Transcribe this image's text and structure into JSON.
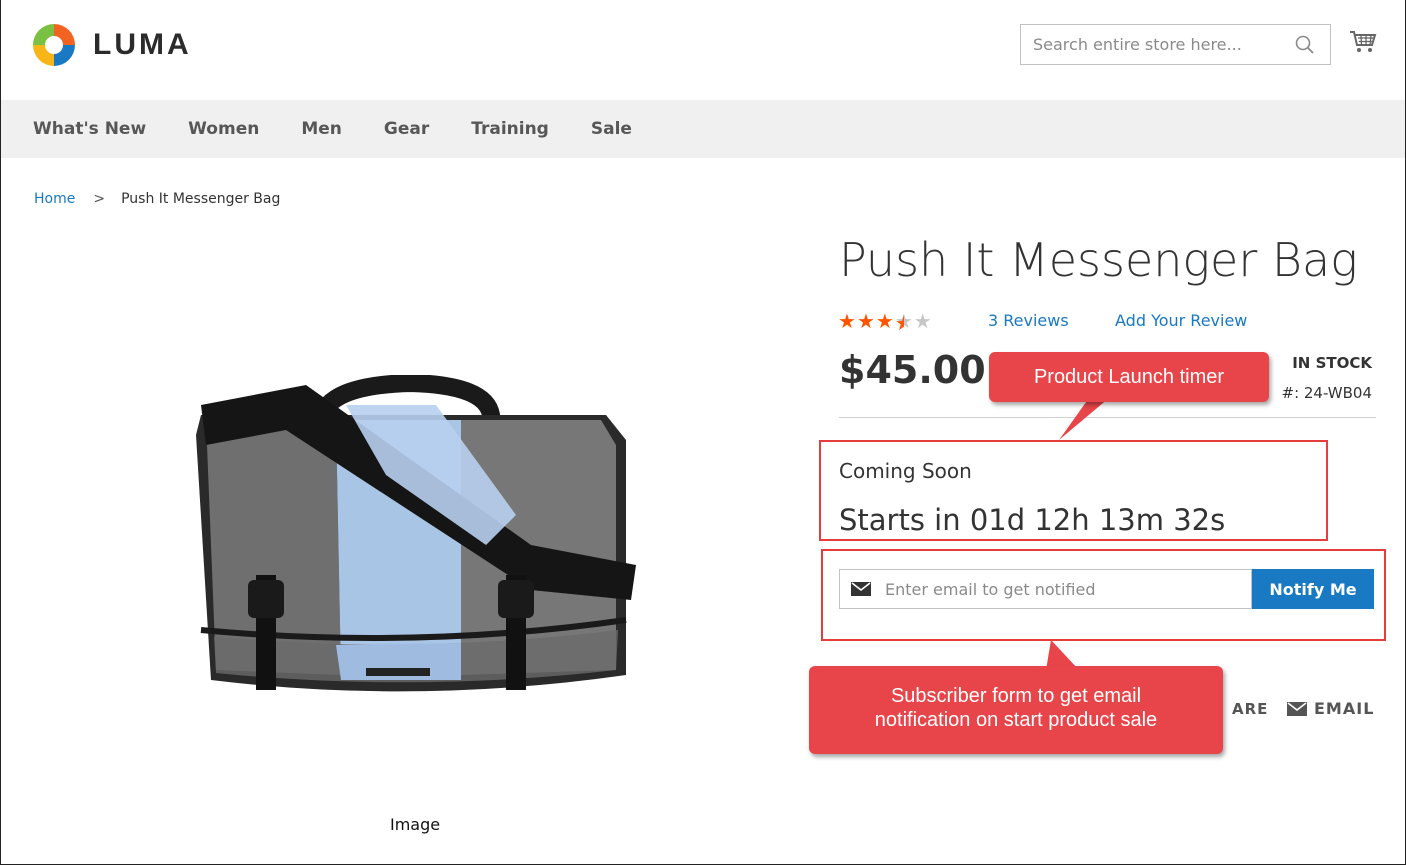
{
  "header": {
    "logo_text": "LUMA",
    "search_placeholder": "Search entire store here..."
  },
  "nav": {
    "items": [
      "What's New",
      "Women",
      "Men",
      "Gear",
      "Training",
      "Sale"
    ]
  },
  "breadcrumb": {
    "home": "Home",
    "separator": ">",
    "current": "Push It Messenger Bag"
  },
  "product": {
    "title": "Push It Messenger Bag",
    "rating": "3.5 of 5",
    "stars": [
      "★",
      "★",
      "★",
      "★",
      "★"
    ],
    "reviews_label": "3 Reviews",
    "add_review_label": "Add Your Review",
    "price": "$45.00",
    "stock": "IN STOCK",
    "sku": "#: 24-WB04",
    "image_caption": "Image"
  },
  "timer": {
    "coming_soon": "Coming Soon",
    "countdown": "Starts in 01d 12h 13m 32s"
  },
  "notify": {
    "email_placeholder": "Enter email to get notified",
    "button_label": "Notify Me"
  },
  "share": {
    "share_partial": "ARE",
    "email_label": "EMAIL"
  },
  "callouts": {
    "timer": "Product Launch timer",
    "form_line1": "Subscriber form to get email",
    "form_line2": "notification on start product sale"
  },
  "colors": {
    "accent": "#1979c3",
    "star": "#ff5501",
    "callout": "#e8454a",
    "highlight_border": "#e53c3c",
    "nav_bg": "#f0f0f0"
  }
}
